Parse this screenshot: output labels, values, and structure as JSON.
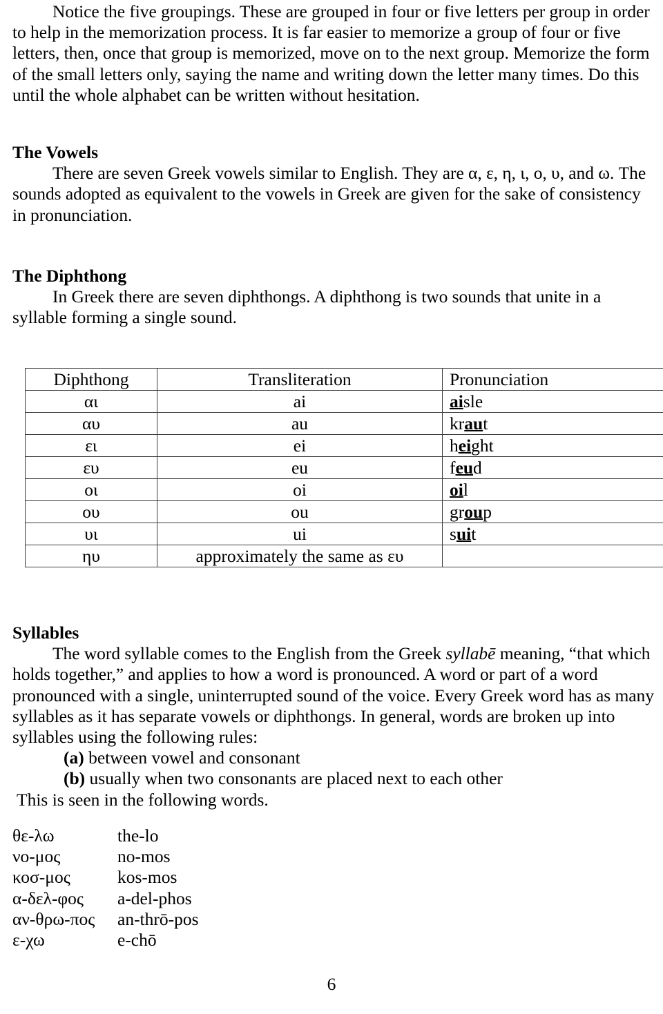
{
  "document": {
    "page_number": "6"
  },
  "intro": {
    "text": "Notice the five groupings. These are grouped in four or five letters per group in order to help in the memorization process. It is far easier to memorize a group of four or five letters, then, once that group is memorized, move on to the next group. Memorize the form of the small letters only, saying the name and writing down the letter many times. Do this until the whole alphabet can be written without hesitation."
  },
  "vowels": {
    "heading": "The Vowels",
    "text": "There are seven Greek vowels similar to English. They are  α, ε, η, ι, ο, υ, and ω. The sounds adopted as equivalent to the vowels in Greek are given for the sake of consistency in pronunciation."
  },
  "diphthong": {
    "heading": "The Diphthong",
    "text": "In Greek there are seven diphthongs. A diphthong is two sounds that unite in a syllable forming a single sound."
  },
  "table": {
    "headers": [
      "Diphthong",
      "Transliteration",
      "Pronunciation"
    ],
    "rows": [
      {
        "diphthong": "αι",
        "transliteration": "ai",
        "pron_pre": "",
        "pron_mark": "ai",
        "pron_post": "sle"
      },
      {
        "diphthong": "αυ",
        "transliteration": "au",
        "pron_pre": "kr",
        "pron_mark": "au",
        "pron_post": "t"
      },
      {
        "diphthong": "ει",
        "transliteration": "ei",
        "pron_pre": "h",
        "pron_mark": "ei",
        "pron_post": "ght"
      },
      {
        "diphthong": "ευ",
        "transliteration": "eu",
        "pron_pre": "f",
        "pron_mark": "eu",
        "pron_post": "d"
      },
      {
        "diphthong": "οι",
        "transliteration": "oi",
        "pron_pre": "",
        "pron_mark": "oi",
        "pron_post": "l"
      },
      {
        "diphthong": "ου",
        "transliteration": "ou",
        "pron_pre": "gr",
        "pron_mark": "ou",
        "pron_post": "p"
      },
      {
        "diphthong": "υι",
        "transliteration": "ui",
        "pron_pre": "s",
        "pron_mark": "ui",
        "pron_post": "t"
      },
      {
        "diphthong": "ηυ",
        "transliteration": "approximately the same as ευ",
        "pron_pre": "",
        "pron_mark": "",
        "pron_post": ""
      }
    ]
  },
  "syllables": {
    "heading": "Syllables",
    "text_before_italic": "The word syllable comes to the English from the Greek ",
    "italic_word": "syllabē",
    "text_after_italic": " meaning, “that which holds together,” and applies to how a word is pronounced. A word or part of a word pronounced with a single, uninterrupted sound of the voice. Every Greek word has as many syllables as it has separate vowels or diphthongs. In general, words are broken up into syllables using the following rules:",
    "rules": [
      {
        "tag": "(a)",
        "text": " between vowel and consonant"
      },
      {
        "tag": "(b)",
        "text": " usually when two consonants are placed next to each other"
      }
    ],
    "closing": "This is seen in the following words."
  },
  "wordlist": [
    {
      "greek": "θε-λω",
      "translit": "the-lo"
    },
    {
      "greek": "νο-μος",
      "translit": "no-mos"
    },
    {
      "greek": "κοσ-μος",
      "translit": "kos-mos"
    },
    {
      "greek": "α-δελ-φος",
      "translit": "a-del-phos"
    },
    {
      "greek": "αν-θρω-πος",
      "translit": "an-thrō-pos"
    },
    {
      "greek": "ε-χω",
      "translit": "e-chō"
    }
  ]
}
